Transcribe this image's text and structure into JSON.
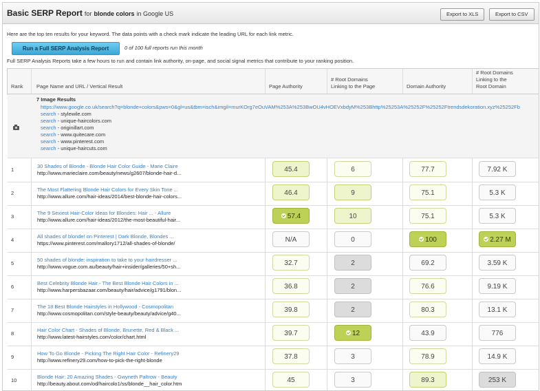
{
  "header": {
    "title": "Basic SERP Report",
    "for_text": "for",
    "keyword": "blonde colors",
    "in_text": "in Google US",
    "export_xls": "Export to XLS",
    "export_csv": "Export to CSV"
  },
  "intro": "Here are the top ten results for your keyword. The data points with a check mark indicate the leading URL for each link metric.",
  "run_button": "Run a Full SERP Analysis Report",
  "run_note": "0 of 100 full reports run this month",
  "full_note": "Full SERP Analysis Reports take a few hours to run and contain link authority, on-page, and social signal metrics that contribute to your ranking position.",
  "columns": {
    "rank": "Rank",
    "page": "Page Name and URL / Vertical Result",
    "pa": "Page Authority",
    "rd_page_1": "# Root Domains",
    "rd_page_2": "Linking to the Page",
    "da": "Domain Authority",
    "rd_domain_1": "# Root Domains",
    "rd_domain_2": "Linking to the",
    "rd_domain_3": "Root Domain"
  },
  "image_results": {
    "title": "7 Image Results",
    "url": "https://www.google.co.uk/search?q=blonde+colors&pws=0&gl=us&tbm=isch&imgil=murKOrg7eOuVAM%253A%253BwOU4vHOEVxbdyM%253Bhttp%25253A%25252F%25252Ftrendsdekoration.xyz%25252Fb",
    "search_word": "search",
    "domains": [
      "stylewile.com",
      "unique-haircolors.com",
      "originillart.com",
      "www.quitecare.com",
      "www.pinterest.com",
      "unique-haircuts.com"
    ]
  },
  "rows": [
    {
      "rank": "1",
      "title": "30 Shades of Blonde - Blonde Hair Color Guide - Marie Claire",
      "url": "http://www.marieclaire.com/beauty/news/g2607/blonde-hair-d...",
      "pa": "45.4",
      "rdp": "6",
      "da": "77.7",
      "rdd": "7.92 K"
    },
    {
      "rank": "2",
      "title": "The Most Flattering Blonde Hair Colors for Every Skin Tone ...",
      "url": "http://www.allure.com/hair-ideas/2014/best-blonde-hair-colors...",
      "pa": "46.4",
      "rdp": "9",
      "da": "75.1",
      "rdd": "5.3 K"
    },
    {
      "rank": "3",
      "title": "The 9 Sexiest Hair-Color Ideas for Blondes: Hair ... - Allure",
      "url": "http://www.allure.com/hair-ideas/2012/the-most-beautiful-hair...",
      "pa": "57.4",
      "rdp": "10",
      "da": "75.1",
      "rdd": "5.3 K"
    },
    {
      "rank": "4",
      "title": "All shades of blonde! on Pinterest | Dark Blonde, Blondes ...",
      "url": "https://www.pinterest.com/mallory1712/all-shades-of-blonde/",
      "pa": "N/A",
      "rdp": "0",
      "da": "100",
      "rdd": "2.27 M"
    },
    {
      "rank": "5",
      "title": "50 shades of blonde: inspiration to take to your hairdresser ...",
      "url": "http://www.vogue.com.au/beauty/hair+insider/galleries/50+sh...",
      "pa": "32.7",
      "rdp": "2",
      "da": "69.2",
      "rdd": "3.59 K"
    },
    {
      "rank": "6",
      "title": "Best Celebrity Blonde Hair - The Best Blonde Hair Colors in ...",
      "url": "http://www.harpersbazaar.com/beauty/hair/advice/g1791/blon...",
      "pa": "36.8",
      "rdp": "2",
      "da": "76.6",
      "rdd": "9.19 K"
    },
    {
      "rank": "7",
      "title": "The 18 Best Blonde Hairstyles in Hollywood - Cosmopolitan",
      "url": "http://www.cosmopolitan.com/style-beauty/beauty/advice/g40...",
      "pa": "39.8",
      "rdp": "2",
      "da": "80.3",
      "rdd": "13.1 K"
    },
    {
      "rank": "8",
      "title": "Hair Color Chart - Shades of Blonde, Brunette, Red & Black ...",
      "url": "http://www.latest-hairstyles.com/color/chart.html",
      "pa": "39.7",
      "rdp": "12",
      "da": "43.9",
      "rdd": "776"
    },
    {
      "rank": "9",
      "title": "How To Go Blonde - Picking The Right Hair Color - Refinery29",
      "url": "http://www.refinery29.com/how-to-pick-the-right-blonde",
      "pa": "37.8",
      "rdp": "3",
      "da": "78.9",
      "rdd": "14.9 K"
    },
    {
      "rank": "10",
      "title": "Blonde Hair: 20 Amazing Shades - Gwyneth Paltrow - Beauty",
      "url": "http://beauty.about.com/od/haircolo1/ss/blonde__hair_color.htm",
      "pa": "45",
      "rdp": "3",
      "da": "89.3",
      "rdd": "253 K"
    }
  ]
}
